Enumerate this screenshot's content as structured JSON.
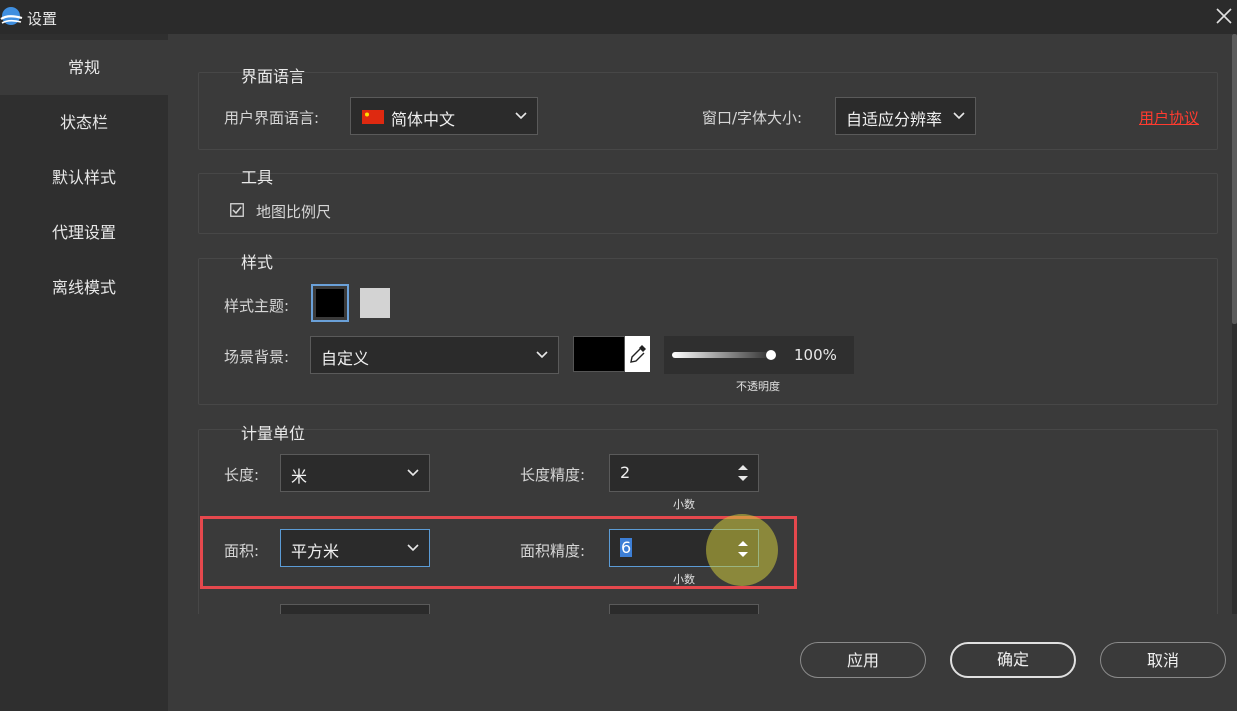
{
  "window": {
    "title": "设置"
  },
  "sidebar": {
    "items": [
      {
        "label": "常规",
        "active": true
      },
      {
        "label": "状态栏",
        "active": false
      },
      {
        "label": "默认样式",
        "active": false
      },
      {
        "label": "代理设置",
        "active": false
      },
      {
        "label": "离线模式",
        "active": false
      }
    ]
  },
  "language": {
    "group_title": "界面语言",
    "ui_language_label": "用户界面语言:",
    "ui_language_value": "简体中文",
    "font_size_label": "窗口/字体大小:",
    "font_size_value": "自适应分辨率",
    "user_agreement": "用户协议"
  },
  "tools": {
    "group_title": "工具",
    "map_scale_label": "地图比例尺",
    "map_scale_checked": true
  },
  "style": {
    "group_title": "样式",
    "theme_label": "样式主题:",
    "theme_dark_color": "#000000",
    "theme_light_color": "#d3d3d3",
    "background_label": "场景背景:",
    "background_value": "自定义",
    "background_color": "#000000",
    "opacity_value": "100%",
    "opacity_fraction": 1.0,
    "opacity_label": "不透明度"
  },
  "units": {
    "group_title": "计量单位",
    "length_label": "长度:",
    "length_value": "米",
    "length_precision_label": "长度精度:",
    "length_precision_value": "2",
    "length_precision_hint": "小数",
    "area_label": "面积:",
    "area_value": "平方米",
    "area_precision_label": "面积精度:",
    "area_precision_value": "6",
    "area_precision_hint": "小数"
  },
  "buttons": {
    "apply": "应用",
    "ok": "确定",
    "cancel": "取消"
  },
  "colors": {
    "highlight_box": "#e5484d",
    "focus_border": "#5b9bd5",
    "link": "#ff3b2f"
  }
}
